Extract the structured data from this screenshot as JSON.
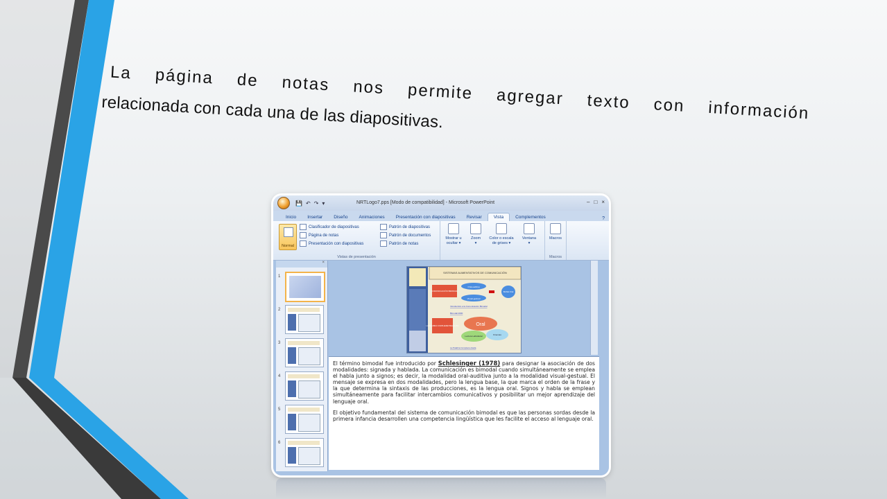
{
  "slide": {
    "line1": [
      "La",
      "página",
      "de",
      "notas",
      "nos",
      "permite",
      "agregar",
      "texto",
      "con",
      "información"
    ],
    "line2_start": "relacionada con cada una de las diapositivas."
  },
  "window": {
    "title": "NRTLogo7.pps [Modo de compatibilidad] - Microsoft PowerPoint",
    "controls": [
      "–",
      "□",
      "×"
    ]
  },
  "tabs": [
    {
      "label": "Inicio",
      "active": false
    },
    {
      "label": "Insertar",
      "active": false
    },
    {
      "label": "Diseño",
      "active": false
    },
    {
      "label": "Animaciones",
      "active": false
    },
    {
      "label": "Presentación con diapositivas",
      "active": false
    },
    {
      "label": "Revisar",
      "active": false
    },
    {
      "label": "Vista",
      "active": true
    },
    {
      "label": "Complementos",
      "active": false
    }
  ],
  "ribbon": {
    "normal": "Normal",
    "views_col1": [
      "Clasificador de diapositivas",
      "Página de notas",
      "Presentación con diapositivas"
    ],
    "views_col2": [
      "Patrón de diapositivas",
      "Patrón de documentos",
      "Patrón de notas"
    ],
    "group_views": "Vistas de presentación",
    "mostrar": "Mostrar u\nocultar ▾",
    "zoom": "Zoom\n▾",
    "color": "Color o escala\nde grises ▾",
    "ventana": "Ventana\n▾",
    "macros": "Macros",
    "group_macros": "Macros"
  },
  "mini_slide": {
    "header": "SISTEMAS AUMENTATIVOS DE COMUNICACIÓN",
    "left_box": "COMUNICACIÓN BIMODAL",
    "oral_aud": "Oral-auditiva",
    "visual": "Visual-gestual",
    "base": "BASE Oral",
    "link1": "Introducción a la Comunicación Bimodal",
    "link2": "Bimodal 2000",
    "lpc": "LA PALABRA COMPLEMENTADA (LPC)",
    "oral": "Oral",
    "lectura": "Lectura Labiofacial",
    "kinemas": "Kinemas",
    "link3": "La Palabra Complementada"
  },
  "notes": {
    "p1a": "El término bimodal fue introducido por",
    "p1name": "Schlesinger (1978)",
    "p1b": "para designar la asociación de dos modalidades: signada y hablada. La comunicación es bimodal cuando simultáneamente se emplea el habla junto a signos; es decir, la modalidad oral-auditiva junto a la modalidad visual-gestual. El mensaje se expresa en dos modalidades, pero la lengua base, la que marca el orden de la frase y la que determina la sintaxis de las producciones, es la lengua oral. Signos y habla se emplean simultáneamente para facilitar intercambios comunicativos y posibilitar un mejor aprendizaje del lenguaje oral.",
    "p2": "El objetivo fundamental del sistema de comunicación bimodal es que las personas sordas desde la primera infancia desarrollen una competencia lingüística que les facilite el acceso al lenguaje oral."
  },
  "thumb_numbers": [
    "1",
    "2",
    "3",
    "4",
    "5",
    "6"
  ],
  "colors": {
    "accent_blue": "#2aa3e6",
    "stripe_dark": "#3a3a3a",
    "office_tab": "#15428b"
  }
}
